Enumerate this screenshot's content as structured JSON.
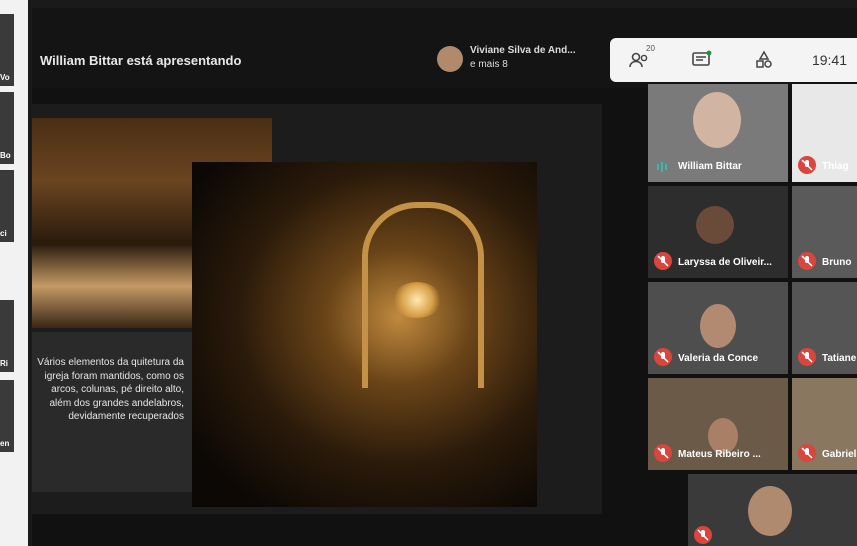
{
  "left_strip": {
    "fragments": [
      "Vo",
      "Bo",
      "ci",
      "Ri",
      "en"
    ]
  },
  "meeting": {
    "presenting_label": "William Bittar está apresentando",
    "viewer_name": "Viviane Silva de And...",
    "viewer_more": "e mais 8",
    "participant_count": "20",
    "clock": "19:41",
    "icons": [
      "people-icon",
      "chat-icon",
      "activities-icon"
    ]
  },
  "slide": {
    "caption": "Vários elementos da quitetura da igreja foram mantidos, como os arcos, colunas, pé direito alto, além dos grandes andelabros, devidamente recuperados"
  },
  "participants": [
    {
      "name": "William Bittar",
      "muted": false
    },
    {
      "name": "Thiag",
      "muted": true
    },
    {
      "name": "Laryssa de Oliveir...",
      "muted": true
    },
    {
      "name": "Bruno",
      "muted": true
    },
    {
      "name": "Valeria da Conce",
      "muted": true
    },
    {
      "name": "Tatiane",
      "muted": true
    },
    {
      "name": "Mateus Ribeiro ...",
      "muted": true
    },
    {
      "name": "Gabriel",
      "muted": true
    },
    {
      "name": "",
      "muted": true
    }
  ],
  "colors": {
    "mute_red": "#d9463e",
    "toolbar_bg": "#f4f4f4",
    "speaking_teal": "#3fb7a8"
  }
}
